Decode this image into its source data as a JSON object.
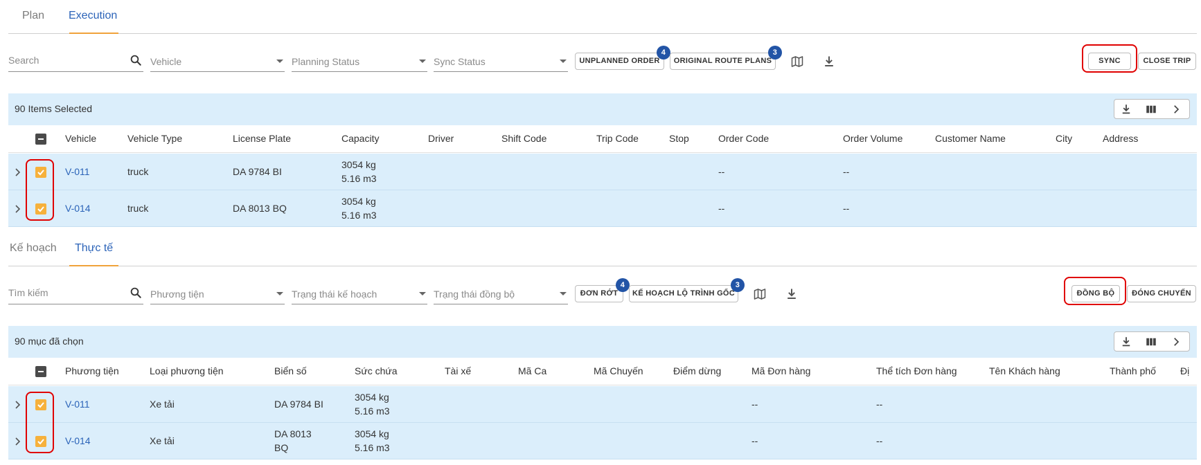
{
  "top": {
    "tabs": [
      {
        "label": "Plan"
      },
      {
        "label": "Execution"
      }
    ],
    "filters": {
      "search_placeholder": "Search",
      "vehicle": "Vehicle",
      "planning_status": "Planning Status",
      "sync_status": "Sync Status"
    },
    "buttons": {
      "unplanned_order": "UNPLANNED ORDER",
      "unplanned_order_count": "4",
      "original_route_plans": "ORIGINAL ROUTE PLANS",
      "original_route_plans_count": "3",
      "sync": "SYNC",
      "close_trip": "CLOSE TRIP"
    },
    "selection_text": "90 Items Selected",
    "columns": [
      "Vehicle",
      "Vehicle Type",
      "License Plate",
      "Capacity",
      "Driver",
      "Shift Code",
      "Trip Code",
      "Stop",
      "Order Code",
      "Order Volume",
      "Customer Name",
      "City",
      "Address"
    ],
    "rows": [
      {
        "vehicle": "V-011",
        "type": "truck",
        "plate": "DA 9784 BI",
        "plate_line2": "",
        "capacity_kg": "3054 kg",
        "capacity_m3": "5.16 m3",
        "order_code": "--",
        "order_volume": "--"
      },
      {
        "vehicle": "V-014",
        "type": "truck",
        "plate": "DA 8013 BQ",
        "plate_line2": "",
        "capacity_kg": "3054 kg",
        "capacity_m3": "5.16 m3",
        "order_code": "--",
        "order_volume": "--"
      }
    ]
  },
  "bottom": {
    "tabs": [
      {
        "label": "Kế hoạch"
      },
      {
        "label": "Thực tế"
      }
    ],
    "filters": {
      "search_placeholder": "Tìm kiếm",
      "vehicle": "Phương tiện",
      "planning_status": "Trạng thái kế hoạch",
      "sync_status": "Trạng thái đồng bộ"
    },
    "buttons": {
      "unplanned_order": "ĐƠN RỚT",
      "unplanned_order_count": "4",
      "original_route_plans": "KẾ HOẠCH LỘ TRÌNH GỐC",
      "original_route_plans_count": "3",
      "sync": "ĐỒNG BỘ",
      "close_trip": "ĐÓNG CHUYẾN"
    },
    "selection_text": "90 mục đã chọn",
    "columns": [
      "Phương tiện",
      "Loại phương tiện",
      "Biển số",
      "Sức chứa",
      "Tài xế",
      "Mã Ca",
      "Mã Chuyến",
      "Điểm dừng",
      "Mã Đơn hàng",
      "Thể tích Đơn hàng",
      "Tên Khách hàng",
      "Thành phố",
      "Đị"
    ],
    "rows": [
      {
        "vehicle": "V-011",
        "type": "Xe tải",
        "plate": "DA 9784 BI",
        "plate_line2": "",
        "capacity_kg": "3054 kg",
        "capacity_m3": "5.16 m3",
        "order_code": "--",
        "order_volume": "--"
      },
      {
        "vehicle": "V-014",
        "type": "Xe tải",
        "plate": "DA 8013",
        "plate_line2": "BQ",
        "capacity_kg": "3054 kg",
        "capacity_m3": "5.16 m3",
        "order_code": "--",
        "order_volume": "--"
      }
    ]
  },
  "colors": {
    "accent_blue": "#2b63b8",
    "tab_underline": "#f0a23a",
    "selected_row_bg": "#dbeefb",
    "checkbox_orange": "#f6b13c",
    "badge_blue": "#2254a6",
    "highlight_red": "#e00000"
  }
}
